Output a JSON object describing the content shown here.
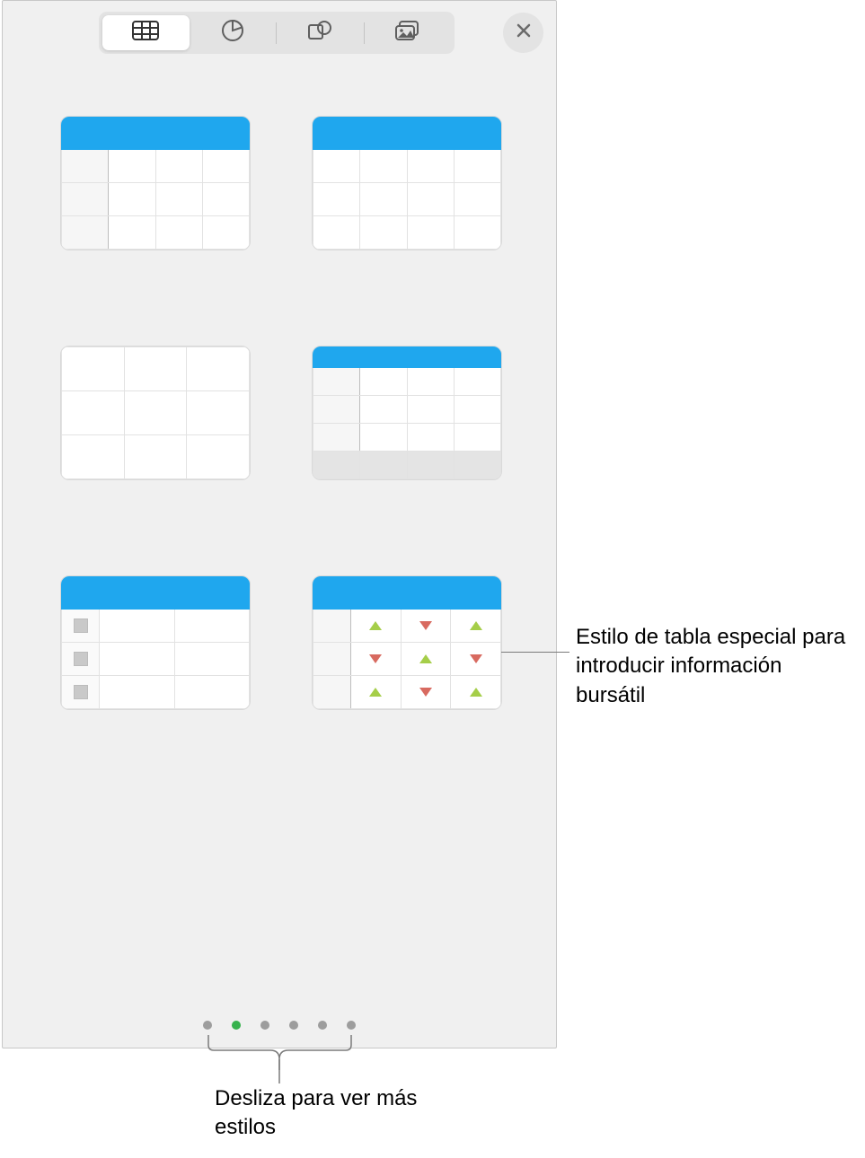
{
  "toolbar": {
    "tabs": [
      "table-icon",
      "chart-icon",
      "shape-icon",
      "media-icon"
    ],
    "active_index": 0
  },
  "close_icon": "close",
  "styles_count": 6,
  "pager": {
    "dots": 6,
    "active_index": 1
  },
  "callout_stock": "Estilo de tabla especial para introducir información bursátil",
  "callout_swipe": "Desliza para ver más estilos",
  "stock_table": {
    "rows": [
      [
        "up",
        "down",
        "up"
      ],
      [
        "down",
        "up",
        "down"
      ],
      [
        "up",
        "down",
        "up"
      ]
    ]
  }
}
